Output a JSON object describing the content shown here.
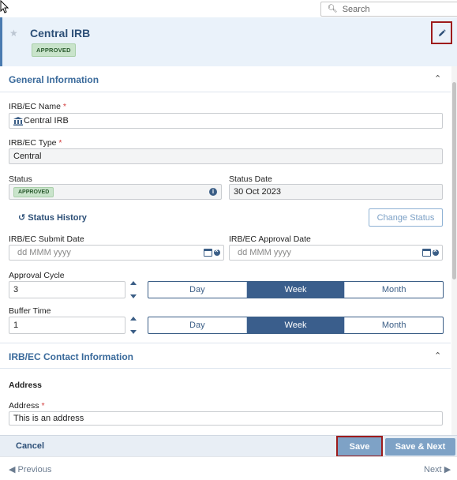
{
  "search": {
    "placeholder": "Search"
  },
  "header": {
    "title": "Central IRB",
    "status_badge": "APPROVED"
  },
  "general_section": {
    "title": "General Information",
    "name_label": "IRB/EC Name",
    "name_value": "Central IRB",
    "type_label": "IRB/EC Type",
    "type_value": "Central",
    "status_label": "Status",
    "status_value": "APPROVED",
    "status_date_label": "Status Date",
    "status_date_value": "30 Oct 2023",
    "status_history_label": "Status History",
    "change_status_label": "Change Status",
    "submit_date_label": "IRB/EC Submit Date",
    "submit_date_placeholder": "dd MMM yyyy",
    "approval_date_label": "IRB/EC Approval Date",
    "approval_date_placeholder": "dd MMM yyyy",
    "approval_cycle_label": "Approval Cycle",
    "approval_cycle_value": "3",
    "buffer_time_label": "Buffer Time",
    "buffer_time_value": "1",
    "units": [
      "Day",
      "Week",
      "Month"
    ],
    "approval_cycle_unit_selected": "Week",
    "buffer_time_unit_selected": "Week"
  },
  "contact_section": {
    "title": "IRB/EC Contact Information",
    "address_heading": "Address",
    "address_label": "Address",
    "address_value": "This is an address"
  },
  "footer": {
    "cancel_label": "Cancel",
    "save_label": "Save",
    "save_next_label": "Save & Next"
  },
  "nav": {
    "previous_label": "Previous",
    "next_label": "Next"
  },
  "colors": {
    "accent": "#3a5e8c",
    "header_bg": "#eaf2fa",
    "required": "#d23b3b",
    "highlight_border": "#9e1c1c"
  }
}
